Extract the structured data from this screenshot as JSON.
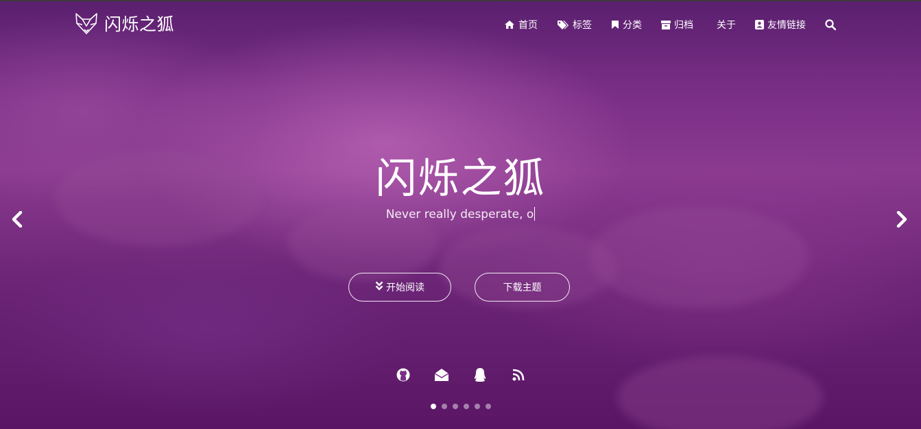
{
  "brand": {
    "name": "闪烁之狐",
    "logo_icon": "fox-logo-icon"
  },
  "nav": [
    {
      "label": "首页",
      "icon": "home-icon"
    },
    {
      "label": "标签",
      "icon": "tags-icon"
    },
    {
      "label": "分类",
      "icon": "bookmark-icon"
    },
    {
      "label": "归档",
      "icon": "archive-icon"
    },
    {
      "label": "关于",
      "icon": ""
    },
    {
      "label": "友情链接",
      "icon": "address-book-icon"
    }
  ],
  "search_icon": "search-icon",
  "hero": {
    "title": "闪烁之狐",
    "subtitle": "Never really desperate, o"
  },
  "buttons": {
    "read_label": "开始阅读",
    "read_icon": "double-chevron-down-icon",
    "download_label": "下载主题"
  },
  "social": [
    "github-icon",
    "email-icon",
    "qq-icon",
    "rss-icon"
  ],
  "carousel": {
    "slides": 6,
    "active_index": 0
  },
  "colors": {
    "accent": "#7a2f86",
    "text": "#ffffff"
  }
}
